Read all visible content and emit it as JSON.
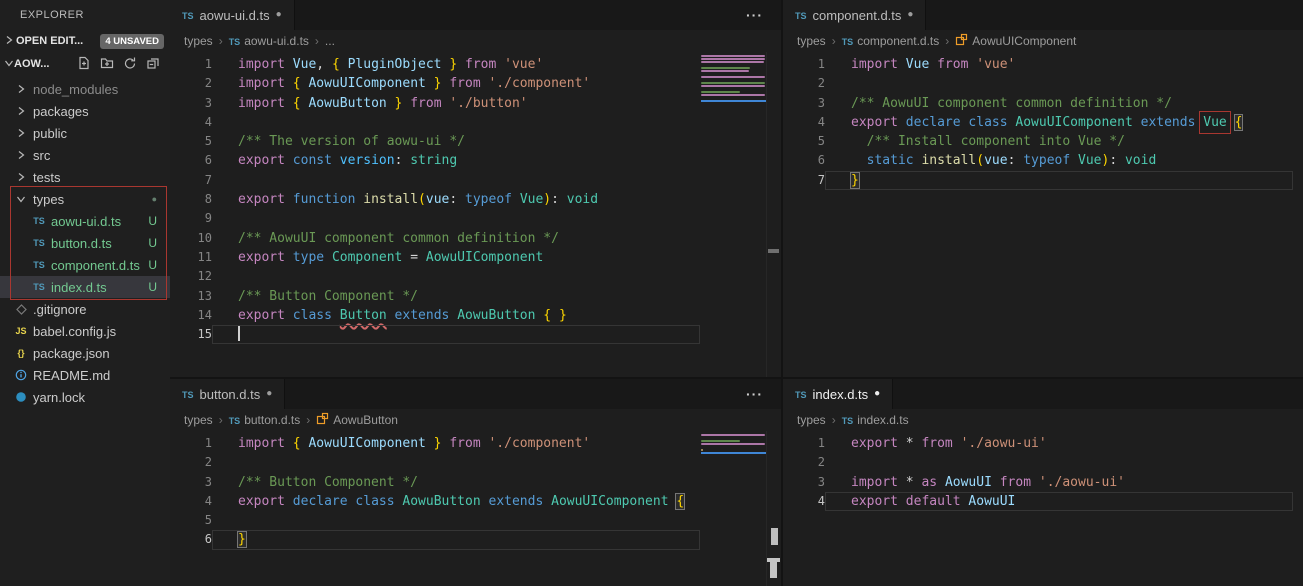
{
  "colors": {
    "accent_red": "#a93730",
    "untracked_green": "#73c991",
    "ts_icon_blue": "#519aba",
    "class_icon_orange": "#ee9d28",
    "editor_bg": "#1e1e1e",
    "sidebar_bg": "#1f1f1f",
    "selection_bg": "#37373d",
    "minimap_highlight_blue": "#3f86d6"
  },
  "sidebar": {
    "title": "EXPLORER",
    "open_editors": {
      "label": "OPEN EDIT...",
      "badge": "4 UNSAVED"
    },
    "section": {
      "label": "AOW...",
      "action_icons": [
        "new-file-icon",
        "new-folder-icon",
        "refresh-icon",
        "collapse-all-icon"
      ]
    },
    "tree": [
      {
        "label": "node_modules",
        "chevron": "right",
        "cls": "dim",
        "level": 1
      },
      {
        "label": "packages",
        "chevron": "right",
        "level": 1
      },
      {
        "label": "public",
        "chevron": "right",
        "level": 1
      },
      {
        "label": "src",
        "chevron": "right",
        "level": 1
      },
      {
        "label": "tests",
        "chevron": "right",
        "level": 1
      },
      {
        "label": "types",
        "chevron": "down",
        "level": 1,
        "badge_dot": true
      },
      {
        "label": "aowu-ui.d.ts",
        "icon": "ts",
        "badge": "U",
        "cls": "untracked",
        "level": 2
      },
      {
        "label": "button.d.ts",
        "icon": "ts",
        "badge": "U",
        "cls": "untracked",
        "level": 2
      },
      {
        "label": "component.d.ts",
        "icon": "ts",
        "badge": "U",
        "cls": "untracked",
        "level": 2
      },
      {
        "label": "index.d.ts",
        "icon": "ts",
        "badge": "U",
        "cls": "untracked",
        "level": 2,
        "selected": true
      },
      {
        "label": ".gitignore",
        "icon": "diamond",
        "level": 1
      },
      {
        "label": "babel.config.js",
        "icon": "js",
        "level": 1
      },
      {
        "label": "package.json",
        "icon": "json",
        "level": 1
      },
      {
        "label": "README.md",
        "icon": "info",
        "level": 1
      },
      {
        "label": "yarn.lock",
        "icon": "yarn",
        "level": 1
      }
    ]
  },
  "editors": [
    {
      "id": "aowu-ui",
      "tab": {
        "label": "aowu-ui.d.ts",
        "dirty": "●"
      },
      "actions": "···",
      "minimap": true,
      "breadcrumb": [
        {
          "label": "types"
        },
        {
          "label": "aowu-ui.d.ts",
          "icon": "ts"
        },
        {
          "label": "..."
        }
      ],
      "lines": [
        {
          "n": 1,
          "tk": [
            [
              "import ",
              "kw"
            ],
            [
              "Vue",
              "var"
            ],
            [
              ", ",
              "pln"
            ],
            [
              "{ ",
              "brk"
            ],
            [
              "PluginObject",
              "var"
            ],
            [
              " }",
              "brk"
            ],
            [
              " from ",
              "kw"
            ],
            [
              "'vue'",
              "str"
            ]
          ]
        },
        {
          "n": 2,
          "tk": [
            [
              "import ",
              "kw"
            ],
            [
              "{ ",
              "brk"
            ],
            [
              "AowuUIComponent",
              "var"
            ],
            [
              " }",
              "brk"
            ],
            [
              " from ",
              "kw"
            ],
            [
              "'./component'",
              "str"
            ]
          ]
        },
        {
          "n": 3,
          "tk": [
            [
              "import ",
              "kw"
            ],
            [
              "{ ",
              "brk"
            ],
            [
              "AowuButton",
              "var"
            ],
            [
              " }",
              "brk"
            ],
            [
              " from ",
              "kw"
            ],
            [
              "'./button'",
              "str"
            ]
          ]
        },
        {
          "n": 4,
          "tk": []
        },
        {
          "n": 5,
          "tk": [
            [
              "/** The version of aowu-ui */",
              "cmt"
            ]
          ]
        },
        {
          "n": 6,
          "tk": [
            [
              "export ",
              "kw"
            ],
            [
              "const ",
              "kw2"
            ],
            [
              "version",
              "varb"
            ],
            [
              ": ",
              "pln"
            ],
            [
              "string",
              "type"
            ]
          ]
        },
        {
          "n": 7,
          "tk": []
        },
        {
          "n": 8,
          "tk": [
            [
              "export ",
              "kw"
            ],
            [
              "function ",
              "kw2"
            ],
            [
              "install",
              "fn"
            ],
            [
              "(",
              "brk"
            ],
            [
              "vue",
              "var"
            ],
            [
              ": ",
              "pln"
            ],
            [
              "typeof ",
              "kw2"
            ],
            [
              "Vue",
              "type"
            ],
            [
              ")",
              "brk"
            ],
            [
              ": ",
              "pln"
            ],
            [
              "void",
              "type"
            ]
          ]
        },
        {
          "n": 9,
          "tk": []
        },
        {
          "n": 10,
          "tk": [
            [
              "/** AowuUI component common definition */",
              "cmt"
            ]
          ]
        },
        {
          "n": 11,
          "tk": [
            [
              "export ",
              "kw"
            ],
            [
              "type ",
              "kw2"
            ],
            [
              "Component",
              "type"
            ],
            [
              " = ",
              "pln"
            ],
            [
              "AowuUIComponent",
              "type"
            ]
          ]
        },
        {
          "n": 12,
          "tk": []
        },
        {
          "n": 13,
          "tk": [
            [
              "/** Button Component */",
              "cmt"
            ]
          ]
        },
        {
          "n": 14,
          "tk": [
            [
              "export ",
              "kw"
            ],
            [
              "class ",
              "kw2"
            ],
            [
              "Button",
              "type",
              "squiggle"
            ],
            [
              " extends ",
              "kw2"
            ],
            [
              "AowuButton",
              "type"
            ],
            [
              " ",
              "pln"
            ],
            [
              "{ }",
              "brk"
            ]
          ]
        },
        {
          "n": 15,
          "tk": [],
          "cur": true,
          "cursor": true
        }
      ]
    },
    {
      "id": "component",
      "tab": {
        "label": "component.d.ts",
        "dirty": "●"
      },
      "actions": null,
      "minimap": false,
      "breadcrumb": [
        {
          "label": "types"
        },
        {
          "label": "component.d.ts",
          "icon": "ts"
        },
        {
          "label": "AowuUIComponent",
          "icon": "class"
        }
      ],
      "lines": [
        {
          "n": 1,
          "tk": [
            [
              "import ",
              "kw"
            ],
            [
              "Vue",
              "var"
            ],
            [
              " from ",
              "kw"
            ],
            [
              "'vue'",
              "str"
            ]
          ]
        },
        {
          "n": 2,
          "tk": []
        },
        {
          "n": 3,
          "tk": [
            [
              "/** AowuUI component common definition */",
              "cmt"
            ]
          ]
        },
        {
          "n": 4,
          "tk": [
            [
              "export ",
              "kw"
            ],
            [
              "declare ",
              "kw2"
            ],
            [
              "class ",
              "kw2"
            ],
            [
              "AowuUIComponent",
              "type"
            ],
            [
              " extends ",
              "kw2"
            ],
            [
              "Vue",
              "type",
              "redbox"
            ],
            [
              " ",
              "pln"
            ],
            [
              "{",
              "brk",
              "match"
            ]
          ]
        },
        {
          "n": 5,
          "tk": [
            [
              "  /** Install component into Vue */",
              "cmt"
            ]
          ]
        },
        {
          "n": 6,
          "tk": [
            [
              "  ",
              "pln"
            ],
            [
              "static ",
              "kw2"
            ],
            [
              "install",
              "fn"
            ],
            [
              "(",
              "brk"
            ],
            [
              "vue",
              "var"
            ],
            [
              ": ",
              "pln"
            ],
            [
              "typeof ",
              "kw2"
            ],
            [
              "Vue",
              "type"
            ],
            [
              ")",
              "brk"
            ],
            [
              ": ",
              "pln"
            ],
            [
              "void",
              "type"
            ]
          ]
        },
        {
          "n": 7,
          "tk": [
            [
              "}",
              "brk",
              "match"
            ]
          ],
          "cur": true
        }
      ]
    },
    {
      "id": "button",
      "tab": {
        "label": "button.d.ts",
        "dirty": "●"
      },
      "actions": "···",
      "minimap": true,
      "breadcrumb": [
        {
          "label": "types"
        },
        {
          "label": "button.d.ts",
          "icon": "ts"
        },
        {
          "label": "AowuButton",
          "icon": "class"
        }
      ],
      "lines": [
        {
          "n": 1,
          "tk": [
            [
              "import ",
              "kw"
            ],
            [
              "{ ",
              "brk"
            ],
            [
              "AowuUIComponent",
              "var"
            ],
            [
              " }",
              "brk"
            ],
            [
              " from ",
              "kw"
            ],
            [
              "'./component'",
              "str"
            ]
          ]
        },
        {
          "n": 2,
          "tk": []
        },
        {
          "n": 3,
          "tk": [
            [
              "/** Button Component */",
              "cmt"
            ]
          ]
        },
        {
          "n": 4,
          "tk": [
            [
              "export ",
              "kw"
            ],
            [
              "declare ",
              "kw2"
            ],
            [
              "class ",
              "kw2"
            ],
            [
              "AowuButton",
              "type"
            ],
            [
              " extends ",
              "kw2"
            ],
            [
              "AowuUIComponent",
              "type"
            ],
            [
              " ",
              "pln"
            ],
            [
              "{",
              "brk",
              "match"
            ]
          ]
        },
        {
          "n": 5,
          "tk": []
        },
        {
          "n": 6,
          "tk": [
            [
              "}",
              "brk",
              "match"
            ]
          ],
          "cur": true
        }
      ]
    },
    {
      "id": "index",
      "tab": {
        "label": "index.d.ts",
        "dirty": "●",
        "focused": true
      },
      "actions": null,
      "minimap": false,
      "breadcrumb": [
        {
          "label": "types"
        },
        {
          "label": "index.d.ts",
          "icon": "ts"
        }
      ],
      "lines": [
        {
          "n": 1,
          "tk": [
            [
              "export ",
              "kw"
            ],
            [
              "* ",
              "pln"
            ],
            [
              "from ",
              "kw"
            ],
            [
              "'./aowu-ui'",
              "str"
            ]
          ]
        },
        {
          "n": 2,
          "tk": []
        },
        {
          "n": 3,
          "tk": [
            [
              "import ",
              "kw"
            ],
            [
              "* ",
              "pln"
            ],
            [
              "as ",
              "kw"
            ],
            [
              "AowuUI",
              "var"
            ],
            [
              " from ",
              "kw"
            ],
            [
              "'./aowu-ui'",
              "str"
            ]
          ]
        },
        {
          "n": 4,
          "tk": [
            [
              "export ",
              "kw"
            ],
            [
              "default ",
              "kw"
            ],
            [
              "AowuUI",
              "var"
            ]
          ],
          "cur": true
        }
      ]
    }
  ]
}
